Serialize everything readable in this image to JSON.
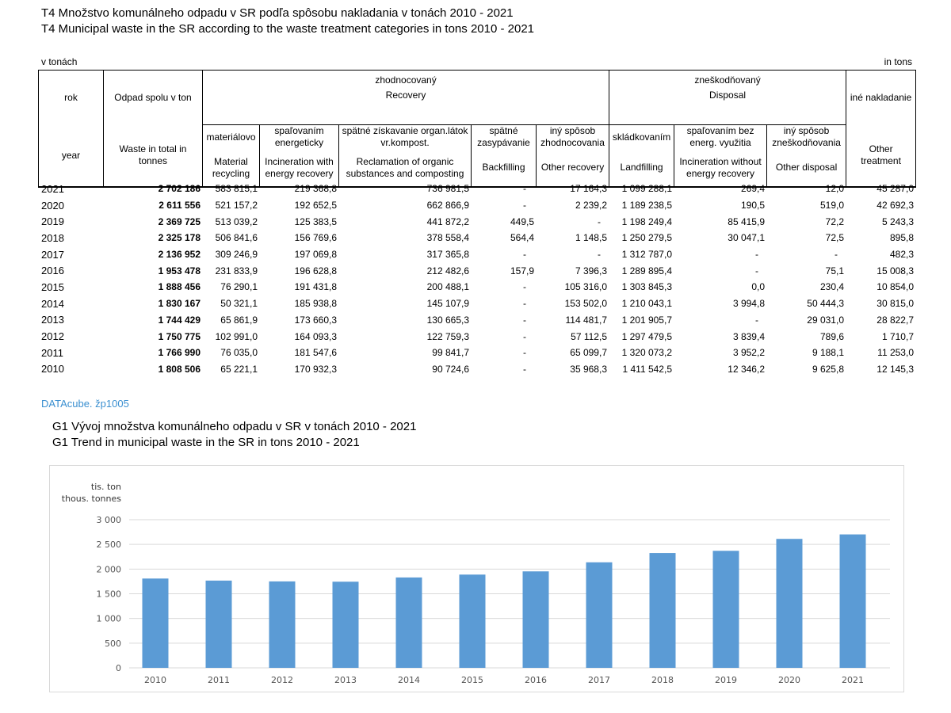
{
  "header": {
    "title_sk": "T4  Množstvo komunálneho odpadu v SR podľa spôsobu nakladania v tonách 2010 - 2021",
    "title_en": "T4  Municipal waste in the SR according to the waste treatment categories in tons 2010 - 2021",
    "unit_left": "v tonách",
    "unit_right": "in tons"
  },
  "table": {
    "head": {
      "rok": "rok",
      "year": "year",
      "total_sk": "Odpad spolu v ton",
      "total_en": "Waste in total in tonnes",
      "recovery_sk": "zhodnocovaný",
      "recovery_en": "Recovery",
      "disposal_sk": "zneškodňovaný",
      "disposal_en": "Disposal",
      "other_sk": "iné nakladanie",
      "other_en": "Other treatment",
      "cols": [
        {
          "sk": "materiálovo",
          "en": "Material recycling"
        },
        {
          "sk": "spaľovaním energeticky",
          "en": "Incineration with energy recovery"
        },
        {
          "sk": "spätné  získavanie organ.látok vr.kompost.",
          "en": "Reclamation of organic substances and composting"
        },
        {
          "sk": "spätné zasypávanie",
          "en": "Backfilling"
        },
        {
          "sk": "iný spôsob zhodnocovania",
          "en": "Other recovery"
        },
        {
          "sk": "skládkovaním",
          "en": "Landfilling"
        },
        {
          "sk": "spaľovaním bez energ. využitia",
          "en": "Incineration without energy recovery"
        },
        {
          "sk": "iný spôsob zneškodňovania",
          "en": "Other disposal"
        }
      ]
    },
    "rows": [
      [
        "2021",
        "2 702 186",
        "583 815,1",
        "219 368,8",
        "736 981,5",
        "-",
        "17 164,3",
        "1 099 288,1",
        "269,4",
        "12,0",
        "45 287,0"
      ],
      [
        "2020",
        "2 611 556",
        "521 157,2",
        "192 652,5",
        "662 866,9",
        "-",
        "2 239,2",
        "1 189 238,5",
        "190,5",
        "519,0",
        "42 692,3"
      ],
      [
        "2019",
        "2 369 725",
        "513 039,2",
        "125 383,5",
        "441 872,2",
        "449,5",
        "-",
        "1 198 249,4",
        "85 415,9",
        "72,2",
        "5 243,3"
      ],
      [
        "2018",
        "2 325 178",
        "506 841,6",
        "156 769,6",
        "378 558,4",
        "564,4",
        "1 148,5",
        "1 250 279,5",
        "30 047,1",
        "72,5",
        "895,8"
      ],
      [
        "2017",
        "2 136 952",
        "309 246,9",
        "197 069,8",
        "317 365,8",
        "-",
        "-",
        "1 312 787,0",
        "-",
        "-",
        "482,3"
      ],
      [
        "2016",
        "1 953 478",
        "231 833,9",
        "196 628,8",
        "212 482,6",
        "157,9",
        "7 396,3",
        "1 289 895,4",
        "-",
        "75,1",
        "15 008,3"
      ],
      [
        "2015",
        "1 888 456",
        "76 290,1",
        "191 431,8",
        "200 488,1",
        "-",
        "105 316,0",
        "1 303 845,3",
        "0,0",
        "230,4",
        "10 854,0"
      ],
      [
        "2014",
        "1 830 167",
        "50 321,1",
        "185 938,8",
        "145 107,9",
        "-",
        "153 502,0",
        "1 210 043,1",
        "3 994,8",
        "50 444,3",
        "30 815,0"
      ],
      [
        "2013",
        "1 744 429",
        "65 861,9",
        "173 660,3",
        "130 665,3",
        "-",
        "114 481,7",
        "1 201 905,7",
        "-",
        "29 031,0",
        "28 822,7"
      ],
      [
        "2012",
        "1 750 775",
        "102 991,0",
        "164 093,3",
        "122 759,3",
        "-",
        "57 112,5",
        "1 297 479,5",
        "3 839,4",
        "789,6",
        "1 710,7"
      ],
      [
        "2011",
        "1 766 990",
        "76 035,0",
        "181 547,6",
        "99 841,7",
        "-",
        "65 099,7",
        "1 320 073,2",
        "3 952,2",
        "9 188,1",
        "11 253,0"
      ],
      [
        "2010",
        "1 808 506",
        "65 221,1",
        "170 932,3",
        "90 724,6",
        "-",
        "35 968,3",
        "1 411 542,5",
        "12 346,2",
        "9 625,8",
        "12 145,3"
      ]
    ]
  },
  "link_text": "DATAcube.  žp1005",
  "graph": {
    "title_sk": "G1  Vývoj množstva komunálneho odpadu v SR v tonách 2010 - 2021",
    "title_en": "G1  Trend in municipal waste in the SR in tons 2010 - 2021"
  },
  "chart_data": {
    "type": "bar",
    "title": "",
    "ylabel": "tis. ton\nthous. tonnes",
    "ylabel_sk": "tis. ton",
    "ylabel_en": "thous. tonnes",
    "xlabel": "",
    "categories": [
      "2010",
      "2011",
      "2012",
      "2013",
      "2014",
      "2015",
      "2016",
      "2017",
      "2018",
      "2019",
      "2020",
      "2021"
    ],
    "values": [
      1808.506,
      1766.99,
      1750.775,
      1744.429,
      1830.167,
      1888.456,
      1953.478,
      2136.952,
      2325.178,
      2369.725,
      2611.556,
      2702.186
    ],
    "ylim": [
      0,
      3000
    ],
    "yticks": [
      "0",
      "500",
      "1 000",
      "1 500",
      "2 000",
      "2 500",
      "3 000"
    ],
    "ytick_values": [
      0,
      500,
      1000,
      1500,
      2000,
      2500,
      3000
    ],
    "bar_color": "#5b9bd5",
    "grid_color": "#d9d9d9",
    "grid": true,
    "legend": "none"
  }
}
